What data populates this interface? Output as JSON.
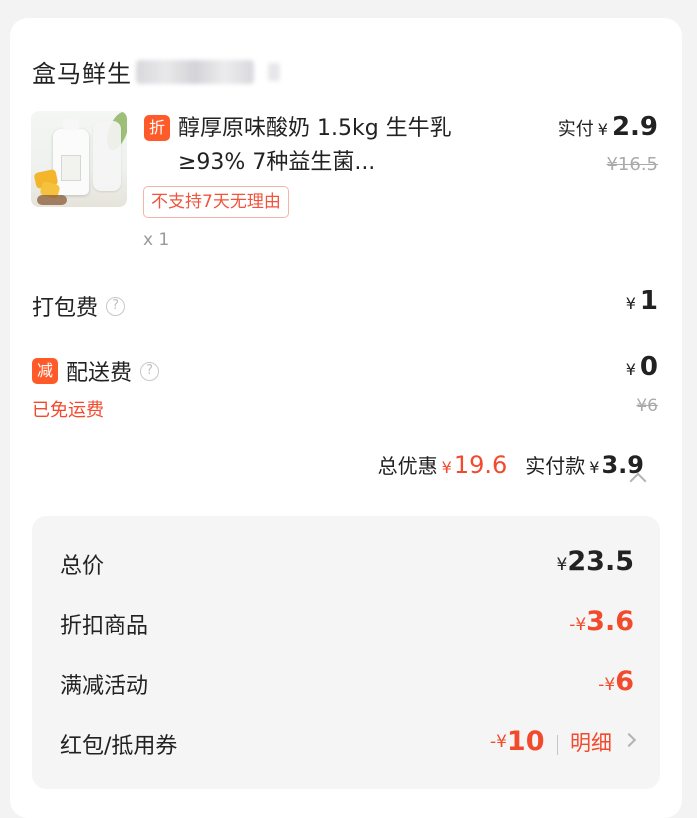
{
  "store": {
    "name": "盒马鲜生"
  },
  "product": {
    "discount_badge": "折",
    "title": "醇厚原味酸奶 1.5kg 生牛乳≥93% 7种益生菌...",
    "tag": "不支持7天无理由",
    "quantity": "x 1",
    "paid_label": "实付",
    "paid_currency": "¥",
    "paid_value": "2.9",
    "original_price": "¥16.5"
  },
  "fees": {
    "packing": {
      "label": "打包费",
      "currency": "¥",
      "value": "1"
    },
    "delivery": {
      "badge": "减",
      "label": "配送费",
      "currency": "¥",
      "value": "0",
      "free_note": "已免运费",
      "original": "¥6"
    }
  },
  "summary": {
    "discount_label": "总优惠",
    "discount_currency": "¥",
    "discount_value": "19.6",
    "paid_label": "实付款",
    "paid_currency": "¥",
    "paid_value": "3.9"
  },
  "breakdown": [
    {
      "label": "总价",
      "sign": "¥",
      "value": "23.5",
      "style": "dark"
    },
    {
      "label": "折扣商品",
      "sign": "-¥",
      "value": "3.6",
      "style": "red"
    },
    {
      "label": "满减活动",
      "sign": "-¥",
      "value": "6",
      "style": "red"
    },
    {
      "label": "红包/抵用券",
      "sign": "-¥",
      "value": "10",
      "style": "red",
      "link": "明细"
    }
  ],
  "colors": {
    "accent": "#f24a2c",
    "badge": "#ff5a2a",
    "text": "#222222",
    "muted": "#aaaaaa"
  },
  "icons": [
    "help-circle-icon",
    "chevron-up-icon",
    "chevron-right-icon"
  ]
}
